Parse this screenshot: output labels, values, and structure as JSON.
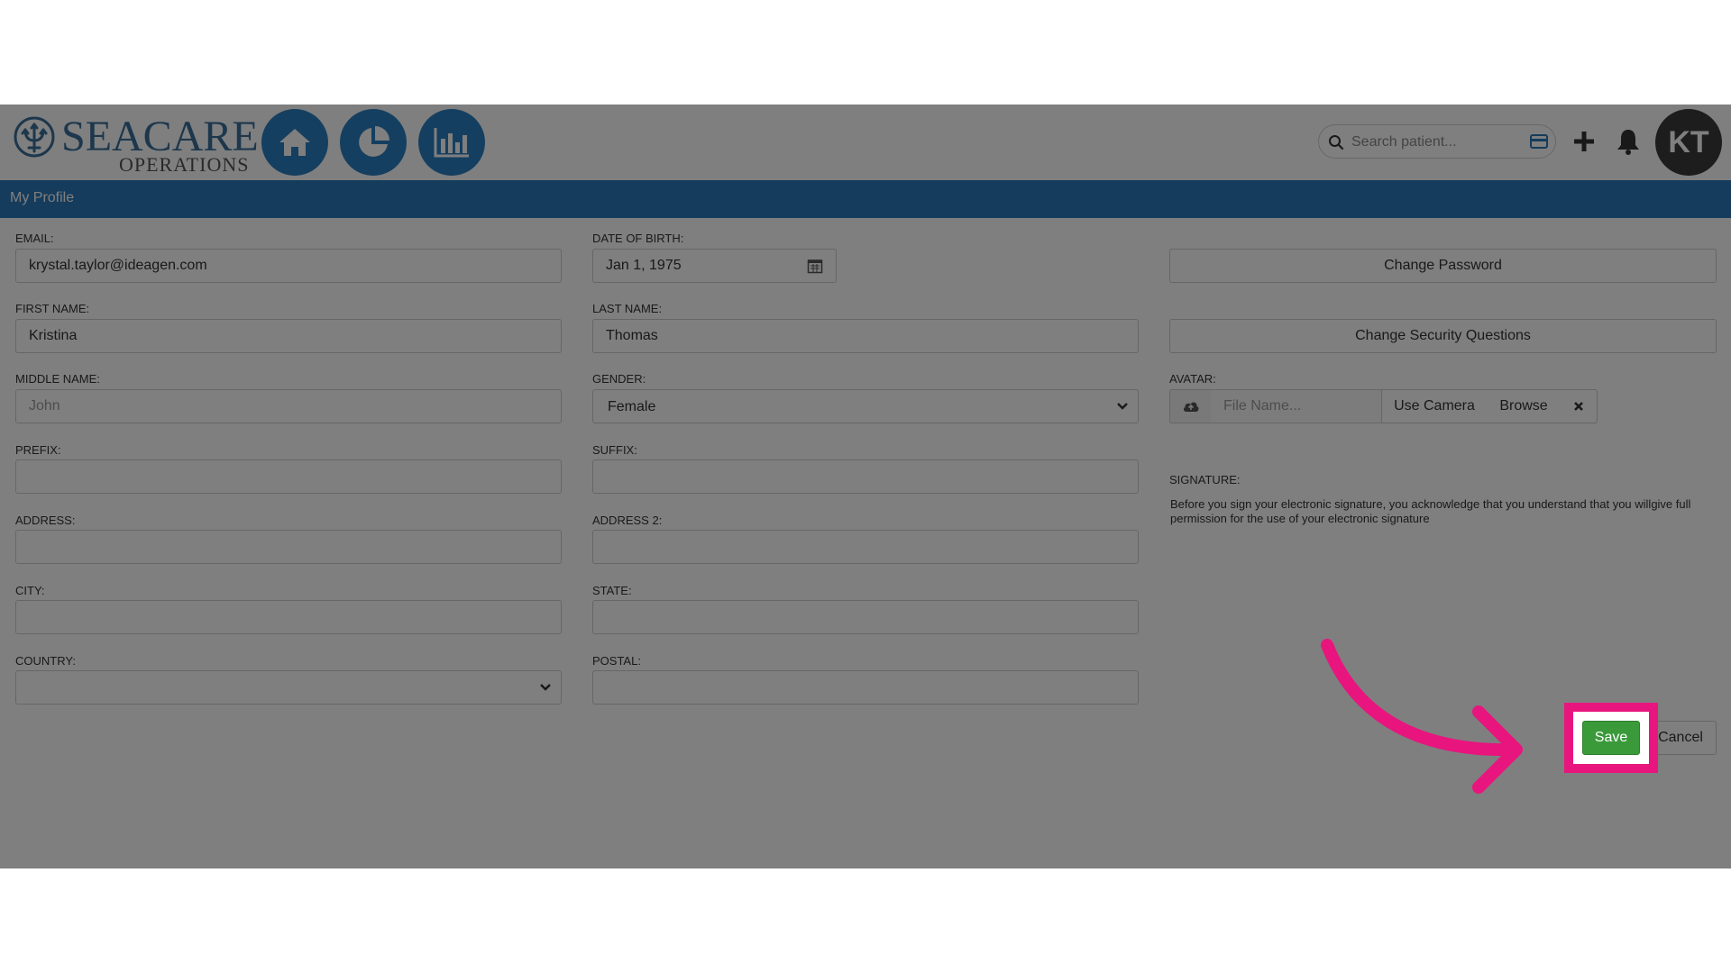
{
  "header": {
    "logo": {
      "name": "SEACARE",
      "sub": "OPERATIONS"
    },
    "nav": [
      "home-icon",
      "pie-chart-icon",
      "bar-chart-icon"
    ],
    "search": {
      "placeholder": "Search patient..."
    },
    "avatar_initials": "KT"
  },
  "page": {
    "title": "My Profile"
  },
  "form": {
    "email": {
      "label": "EMAIL:",
      "value": "krystal.taylor@ideagen.com"
    },
    "dob": {
      "label": "DATE OF BIRTH:",
      "value": "Jan 1, 1975"
    },
    "first_name": {
      "label": "FIRST NAME:",
      "value": "Kristina"
    },
    "last_name": {
      "label": "LAST NAME:",
      "value": "Thomas"
    },
    "middle_name": {
      "label": "MIDDLE NAME:",
      "value": "",
      "placeholder": "John"
    },
    "gender": {
      "label": "GENDER:",
      "value": "Female"
    },
    "prefix": {
      "label": "PREFIX:",
      "value": ""
    },
    "suffix": {
      "label": "SUFFIX:",
      "value": ""
    },
    "address": {
      "label": "ADDRESS:",
      "value": ""
    },
    "address2": {
      "label": "ADDRESS 2:",
      "value": ""
    },
    "city": {
      "label": "CITY:",
      "value": ""
    },
    "state": {
      "label": "STATE:",
      "value": ""
    },
    "country": {
      "label": "COUNTRY:",
      "value": ""
    },
    "postal": {
      "label": "POSTAL:",
      "value": ""
    }
  },
  "side": {
    "change_password": "Change Password",
    "change_security": "Change Security Questions",
    "avatar": {
      "label": "AVATAR:",
      "file_placeholder": "File Name...",
      "use_camera": "Use Camera",
      "browse": "Browse"
    },
    "signature": {
      "label": "SIGNATURE:",
      "text": "Before you sign your electronic signature, you acknowledge that you understand that you willgive full permission for the use of your electronic signature"
    }
  },
  "actions": {
    "save": "Save",
    "cancel": "Cancel"
  },
  "colors": {
    "brand": "#2a78b9",
    "highlight": "#e8157e",
    "save": "#3a9a3a"
  }
}
